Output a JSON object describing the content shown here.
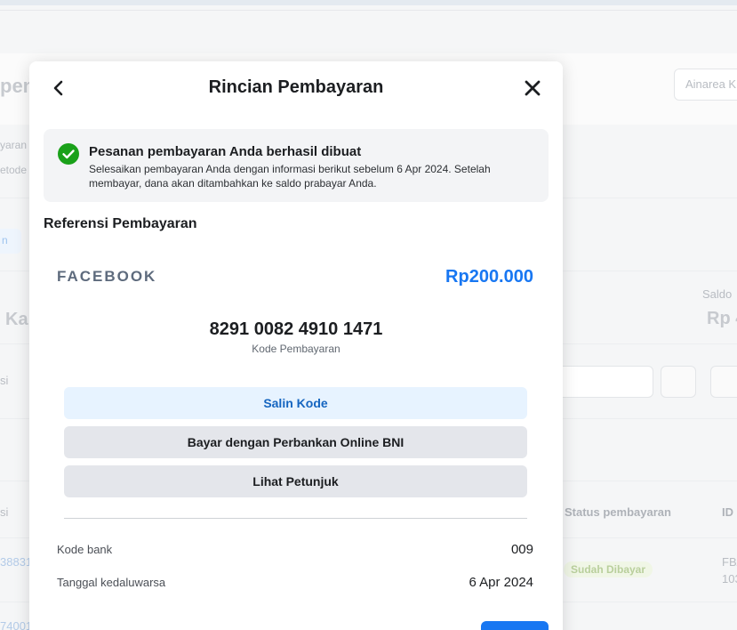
{
  "background": {
    "title_fragment": "pem",
    "search_placeholder": "Ainarea K",
    "desc_fragment_1": "yaran",
    "desc_fragment_2": "etode",
    "chip_fragment": "n",
    "balance_label": "Saldo",
    "balance_value": "Rp 4",
    "card_fragment": "Kar",
    "filter_fragment": "si",
    "col_left_fragment": "si",
    "col_status": "Status pembayaran",
    "col_id": "ID",
    "row1_id_fragment": "38831",
    "row1_status": "Sudah Dibayar",
    "row1_ref_1": "FB/",
    "row1_ref_2": "103",
    "row2_id_fragment": "74001"
  },
  "modal": {
    "title": "Rincian Pembayaran",
    "notice": {
      "title": "Pesanan pembayaran Anda berhasil dibuat",
      "body": "Selesaikan pembayaran Anda dengan informasi berikut sebelum 6 Apr 2024. Setelah membayar, dana akan ditambahkan ke saldo prabayar Anda."
    },
    "section_title": "Referensi Pembayaran",
    "merchant": "FACEBOOK",
    "amount": "Rp200.000",
    "payment_code": "8291 0082 4910 1471",
    "payment_code_label": "Kode Pembayaran",
    "buttons": {
      "copy": "Salin Kode",
      "bank": "Bayar dengan Perbankan Online BNI",
      "guide": "Lihat Petunjuk"
    },
    "details": [
      {
        "label": "Kode bank",
        "value": "009"
      },
      {
        "label": "Tanggal kedaluwarsa",
        "value": "6 Apr 2024"
      }
    ]
  },
  "colors": {
    "accent": "#1877f2",
    "success": "#1aa11a",
    "copy_button_bg": "#e7f3ff",
    "secondary_button_bg": "#e4e6eb"
  }
}
